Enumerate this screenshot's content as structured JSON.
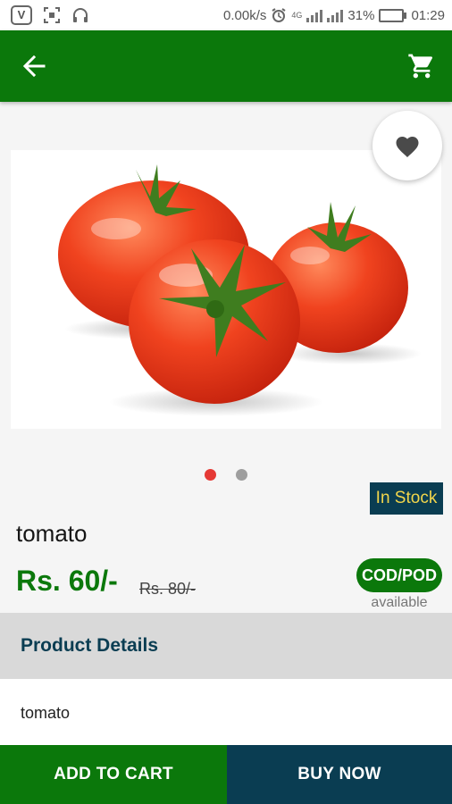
{
  "status_bar": {
    "app_badge": "V",
    "network_speed": "0.00k/s",
    "net_type_small": "4G",
    "battery_percent": "31%",
    "battery_level": 0.31,
    "time": "01:29"
  },
  "app_bar": {
    "color": "#0b780b",
    "back_icon": "arrow-left-icon",
    "cart_icon": "shopping-cart-icon"
  },
  "carousel": {
    "image_subject": "tomatoes",
    "dots_count": 2,
    "active_index": 0
  },
  "product": {
    "stock_label": "In Stock",
    "name": "tomato",
    "price": "Rs. 60/-",
    "mrp": "Rs. 80/-",
    "cod_label": "COD/POD",
    "cod_subtext": "available"
  },
  "details": {
    "header": "Product Details",
    "description": "tomato"
  },
  "actions": {
    "add_to_cart": "ADD TO CART",
    "buy_now": "BUY NOW"
  },
  "colors": {
    "brand_green": "#0b780b",
    "navy": "#0a3d52",
    "stock_text": "#f2d64b",
    "active_dot": "#e53935"
  }
}
